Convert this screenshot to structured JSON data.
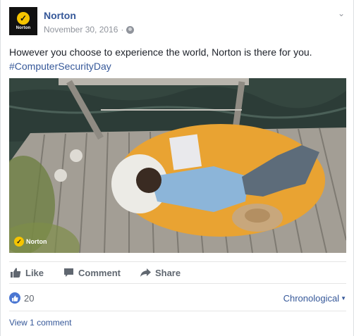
{
  "post": {
    "page_name": "Norton",
    "date": "November 30, 2016",
    "separator": "·",
    "message": "However you choose to experience the world, Norton is there for you.",
    "hashtag": "#ComputerSecurityDay",
    "avatar_brand": "Norton",
    "photo_logo": "Norton",
    "options_icon": "chevron-down-icon",
    "privacy_icon": "globe-icon"
  },
  "actions": {
    "like_label": "Like",
    "comment_label": "Comment",
    "share_label": "Share"
  },
  "reactions": {
    "like_count": "20",
    "sort_label": "Chronological"
  },
  "comments": {
    "view_label": "View 1 comment"
  },
  "colors": {
    "link": "#365899",
    "norton_yellow": "#f5c400",
    "like_blue": "#4a76d2",
    "muted": "#90949c"
  }
}
